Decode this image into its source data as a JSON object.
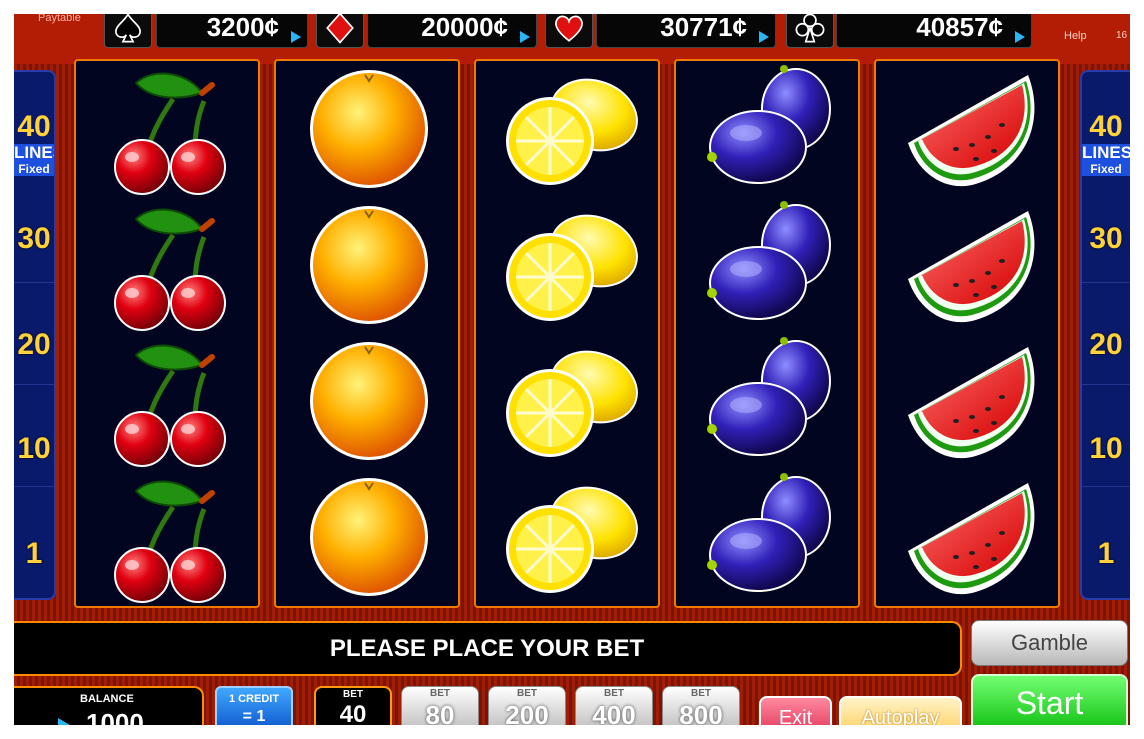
{
  "top_bar": {
    "paytable_label": "Paytable",
    "help_label": "Help",
    "help_number": "16",
    "jackpots": [
      {
        "suit": "spades",
        "suit_icon": "spade-icon",
        "value": "3200¢"
      },
      {
        "suit": "diamonds",
        "suit_icon": "diamond-icon",
        "value": "20000¢"
      },
      {
        "suit": "hearts",
        "suit_icon": "heart-icon",
        "value": "30771¢"
      },
      {
        "suit": "clubs",
        "suit_icon": "club-icon",
        "value": "40857¢"
      }
    ]
  },
  "lines_panel": {
    "count": "40",
    "label": "LINES",
    "sublabel": "Fixed",
    "markers": [
      "30",
      "20",
      "10",
      "1"
    ]
  },
  "reels": [
    {
      "symbol": "cherries",
      "rows": 4
    },
    {
      "symbol": "orange",
      "rows": 4
    },
    {
      "symbol": "lemon",
      "rows": 4
    },
    {
      "symbol": "plums",
      "rows": 4
    },
    {
      "symbol": "watermelon",
      "rows": 4
    }
  ],
  "message": "PLEASE PLACE YOUR BET",
  "controls": {
    "gamble_label": "Gamble",
    "start_label": "Start",
    "exit_label": "Exit",
    "autoplay_label": "Autoplay",
    "balance_label": "BALANCE",
    "balance_value": "1000",
    "credit_label": "1 CREDIT",
    "credit_value": "= 1",
    "bet_caption": "BET",
    "bets": [
      "40",
      "80",
      "200",
      "400",
      "800"
    ],
    "selected_bet": "40"
  },
  "colors": {
    "frame_red": "#b31d06",
    "reel_border": "#f07a00",
    "reel_bg": "#02051f",
    "line_number_yellow": "#ffd23a",
    "start_green": "#12c012"
  }
}
